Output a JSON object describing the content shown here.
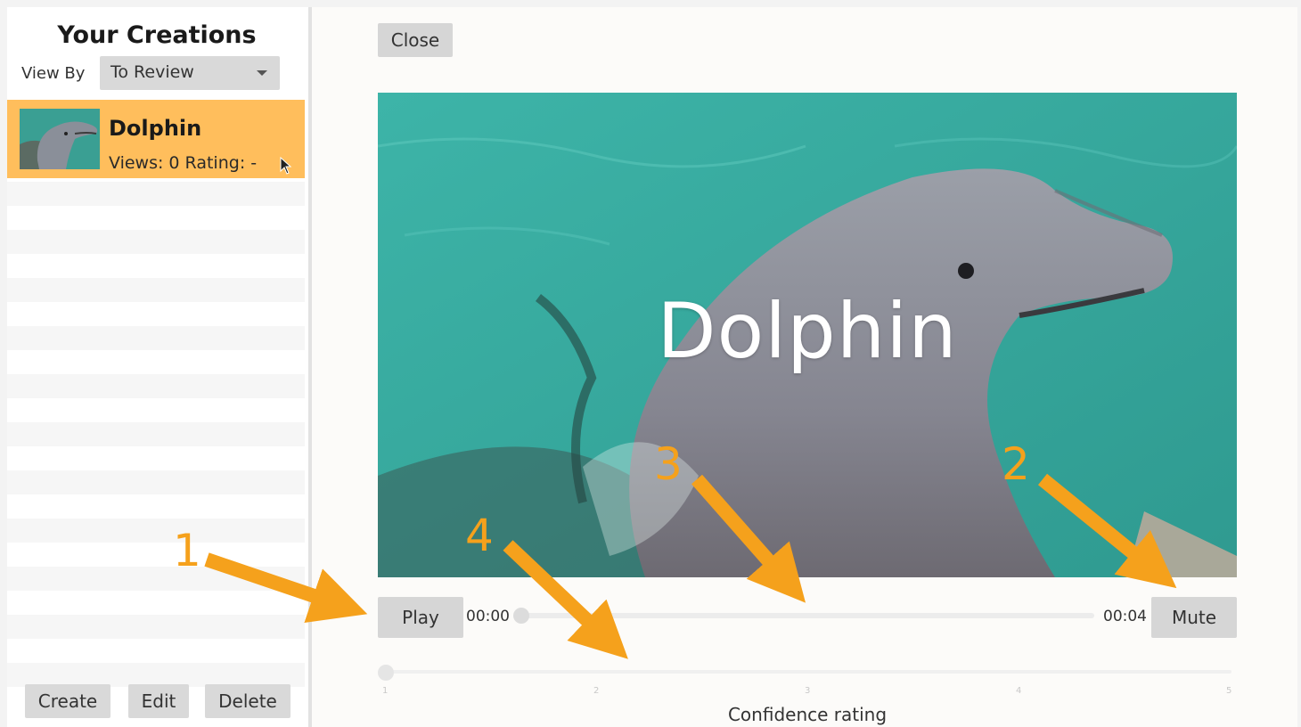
{
  "sidebar": {
    "title": "Your Creations",
    "view_by_label": "View By",
    "view_by_selected": "To Review",
    "items": [
      {
        "name": "Dolphin",
        "meta": "Views: 0 Rating: -"
      }
    ],
    "buttons": {
      "create": "Create",
      "edit": "Edit",
      "delete": "Delete"
    }
  },
  "player": {
    "close_label": "Close",
    "caption": "Dolphin",
    "play_label": "Play",
    "mute_label": "Mute",
    "time_current": "00:00",
    "time_total": "00:04",
    "progress": 0
  },
  "rating": {
    "label": "Confidence rating",
    "ticks": [
      "1",
      "2",
      "3",
      "4",
      "5"
    ],
    "value": 1
  },
  "annotations": {
    "color": "#f5a11c",
    "numbers": [
      "1",
      "2",
      "3",
      "4"
    ]
  },
  "colors": {
    "selected_item": "#ffbe5c",
    "button_bg": "#d6d6d6"
  }
}
